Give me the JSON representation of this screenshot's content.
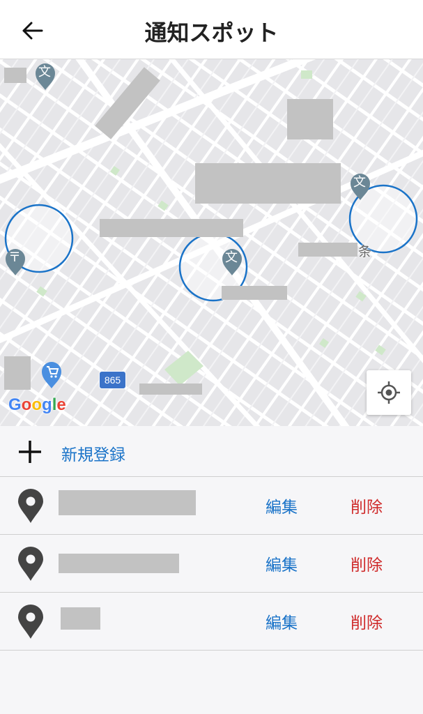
{
  "header": {
    "title": "通知スポット"
  },
  "map": {
    "google_logo": [
      "G",
      "o",
      "o",
      "g",
      "l",
      "e"
    ],
    "google_colors": [
      "#4285F4",
      "#EA4335",
      "#FBBC05",
      "#4285F4",
      "#34A853",
      "#EA4335"
    ],
    "route_number": "865",
    "label_jo": "条",
    "school_icon_glyph": "文",
    "post_icon_glyph": "〒",
    "circle_color": "#1a73c8"
  },
  "add": {
    "label": "新規登録"
  },
  "spots": [
    {
      "edit_label": "編集",
      "delete_label": "削除"
    },
    {
      "edit_label": "編集",
      "delete_label": "削除"
    },
    {
      "edit_label": "編集",
      "delete_label": "削除"
    }
  ],
  "colors": {
    "accent": "#1a73c8",
    "danger": "#cf2a2a",
    "icon": "#444444"
  }
}
